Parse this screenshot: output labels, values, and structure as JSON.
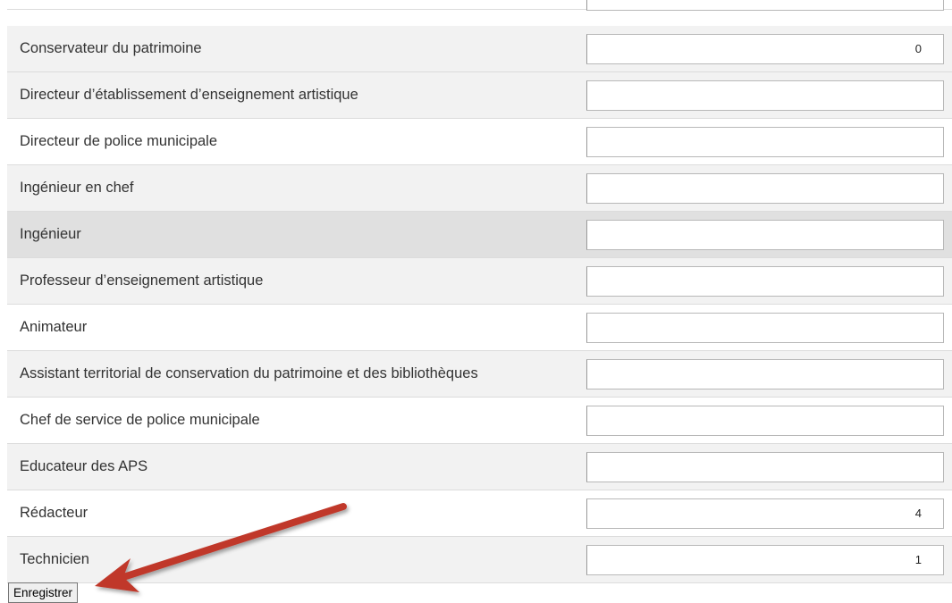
{
  "form": {
    "rows": [
      {
        "label": "Conservateur du patrimoine",
        "value": "0"
      },
      {
        "label": "Directeur d’établissement d’enseignement artistique",
        "value": ""
      },
      {
        "label": "Directeur de police municipale",
        "value": ""
      },
      {
        "label": "Ingénieur en chef",
        "value": ""
      },
      {
        "label": "Ingénieur",
        "value": ""
      },
      {
        "label": "Professeur d’enseignement artistique",
        "value": ""
      },
      {
        "label": "Animateur",
        "value": ""
      },
      {
        "label": "Assistant territorial de conservation du patrimoine et des bibliothèques",
        "value": ""
      },
      {
        "label": "Chef de service de police municipale",
        "value": ""
      },
      {
        "label": "Educateur des APS",
        "value": ""
      },
      {
        "label": "Rédacteur",
        "value": "4"
      },
      {
        "label": "Technicien",
        "value": "1"
      }
    ]
  },
  "actions": {
    "save_label": "Enregistrer"
  },
  "annotation": {
    "arrow_color": "#c0392b"
  }
}
